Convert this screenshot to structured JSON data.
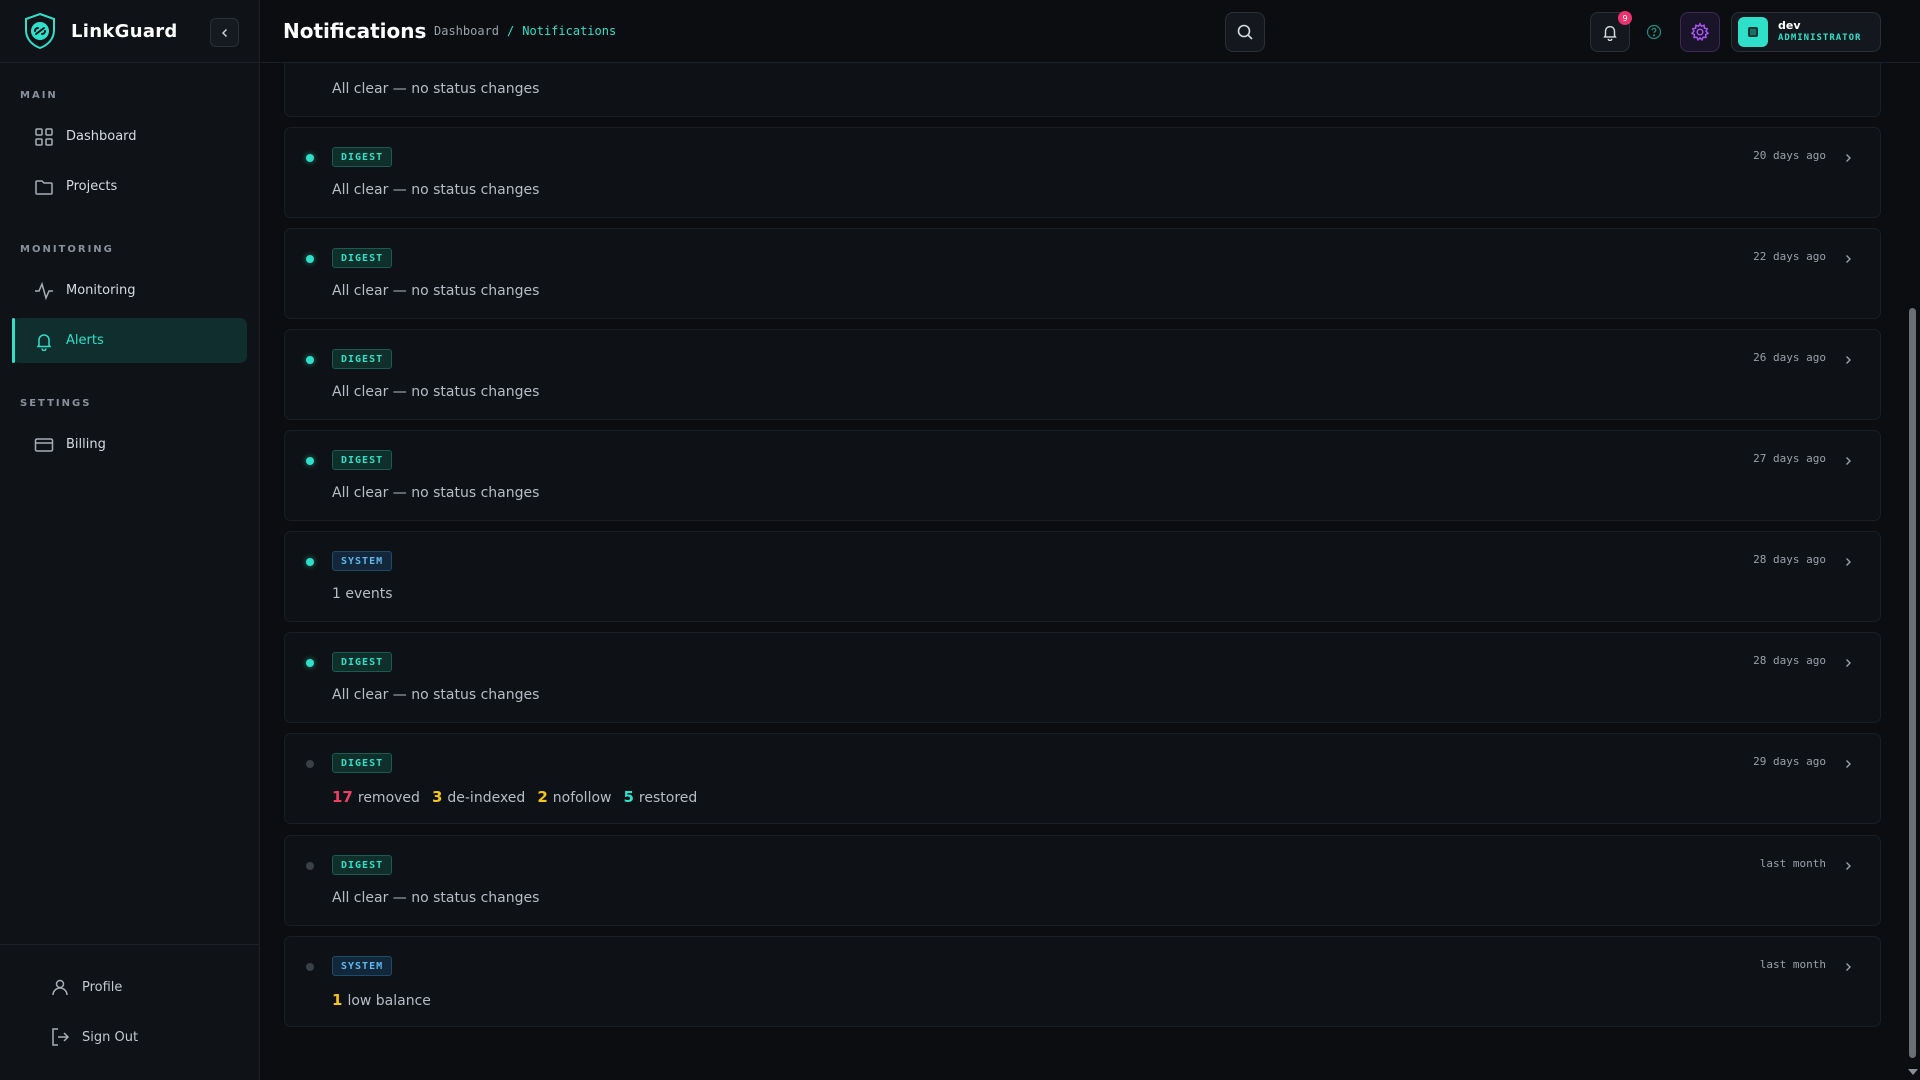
{
  "brand": {
    "name": "LinkGuard"
  },
  "sidebar": {
    "sections": [
      {
        "label": "MAIN"
      },
      {
        "label": "MONITORING"
      },
      {
        "label": "SETTINGS"
      }
    ],
    "items": [
      {
        "label": "Dashboard",
        "icon": "grid-icon"
      },
      {
        "label": "Projects",
        "icon": "folder-icon"
      },
      {
        "label": "Monitoring",
        "icon": "activity-icon"
      },
      {
        "label": "Alerts",
        "icon": "bell-icon",
        "active": true
      },
      {
        "label": "Billing",
        "icon": "credit-card-icon"
      }
    ],
    "bottom": [
      {
        "label": "Profile",
        "icon": "user-icon"
      },
      {
        "label": "Sign Out",
        "icon": "sign-out-icon"
      }
    ]
  },
  "header": {
    "title": "Notifications",
    "breadcrumb": {
      "home": "Dashboard",
      "separator": "/",
      "current": "Notifications"
    },
    "notification_count": "9",
    "user": {
      "name": "dev",
      "role": "ADMINISTRATOR"
    }
  },
  "colors": {
    "accent": "#2fe0c8",
    "danger": "#ef3e6c",
    "warning": "#f5c518",
    "system": "#5fb8f0"
  },
  "notifications": [
    {
      "type": "",
      "message": "All clear — no status changes",
      "time": "",
      "unread": true
    },
    {
      "type": "DIGEST",
      "message": "All clear — no status changes",
      "time": "20 days ago",
      "unread": true
    },
    {
      "type": "DIGEST",
      "message": "All clear — no status changes",
      "time": "22 days ago",
      "unread": true
    },
    {
      "type": "DIGEST",
      "message": "All clear — no status changes",
      "time": "26 days ago",
      "unread": true
    },
    {
      "type": "DIGEST",
      "message": "All clear — no status changes",
      "time": "27 days ago",
      "unread": true
    },
    {
      "type": "SYSTEM",
      "message": "1 events",
      "time": "28 days ago",
      "unread": true
    },
    {
      "type": "DIGEST",
      "message": "All clear — no status changes",
      "time": "28 days ago",
      "unread": true
    },
    {
      "type": "DIGEST",
      "stats": [
        {
          "count": "17",
          "label": "removed",
          "tone": "red"
        },
        {
          "count": "3",
          "label": "de-indexed",
          "tone": "yellow"
        },
        {
          "count": "2",
          "label": "nofollow",
          "tone": "yellow"
        },
        {
          "count": "5",
          "label": "restored",
          "tone": "teal"
        }
      ],
      "time": "29 days ago",
      "unread": false
    },
    {
      "type": "DIGEST",
      "message": "All clear — no status changes",
      "time": "last month",
      "unread": false
    },
    {
      "type": "SYSTEM",
      "stats": [
        {
          "count": "1",
          "label": "low balance",
          "tone": "yellow"
        }
      ],
      "time": "last month",
      "unread": false
    }
  ]
}
